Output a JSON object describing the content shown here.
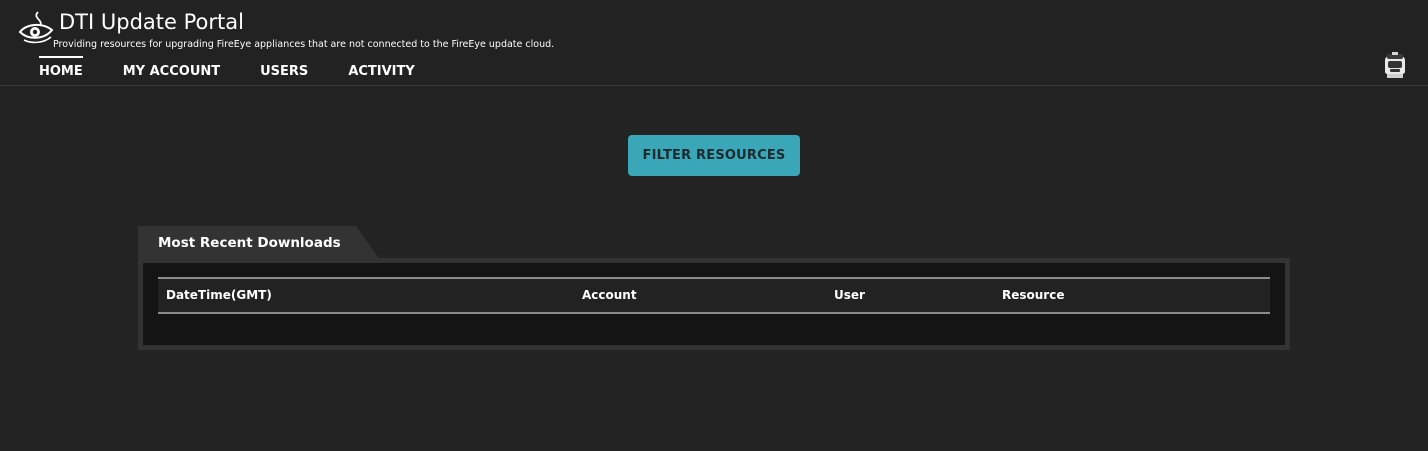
{
  "app": {
    "title": "DTI Update Portal",
    "subtitle": "Providing resources for upgrading FireEye appliances that are not connected to the FireEye update cloud."
  },
  "nav": {
    "items": [
      {
        "label": "HOME",
        "active": true
      },
      {
        "label": "MY ACCOUNT",
        "active": false
      },
      {
        "label": "USERS",
        "active": false
      },
      {
        "label": "ACTIVITY",
        "active": false
      }
    ]
  },
  "icons": {
    "logo": "fireeye-eye-logo-icon",
    "user": "user-avatar-icon"
  },
  "main": {
    "filter_button_label": "FILTER RESOURCES"
  },
  "downloads": {
    "tab_label": "Most Recent Downloads",
    "columns": [
      "DateTime(GMT)",
      "Account",
      "User",
      "Resource"
    ],
    "rows": []
  },
  "colors": {
    "background": "#232323",
    "accent": "#3aa7b8",
    "panel": "#333333",
    "panel_inner": "#141414"
  }
}
